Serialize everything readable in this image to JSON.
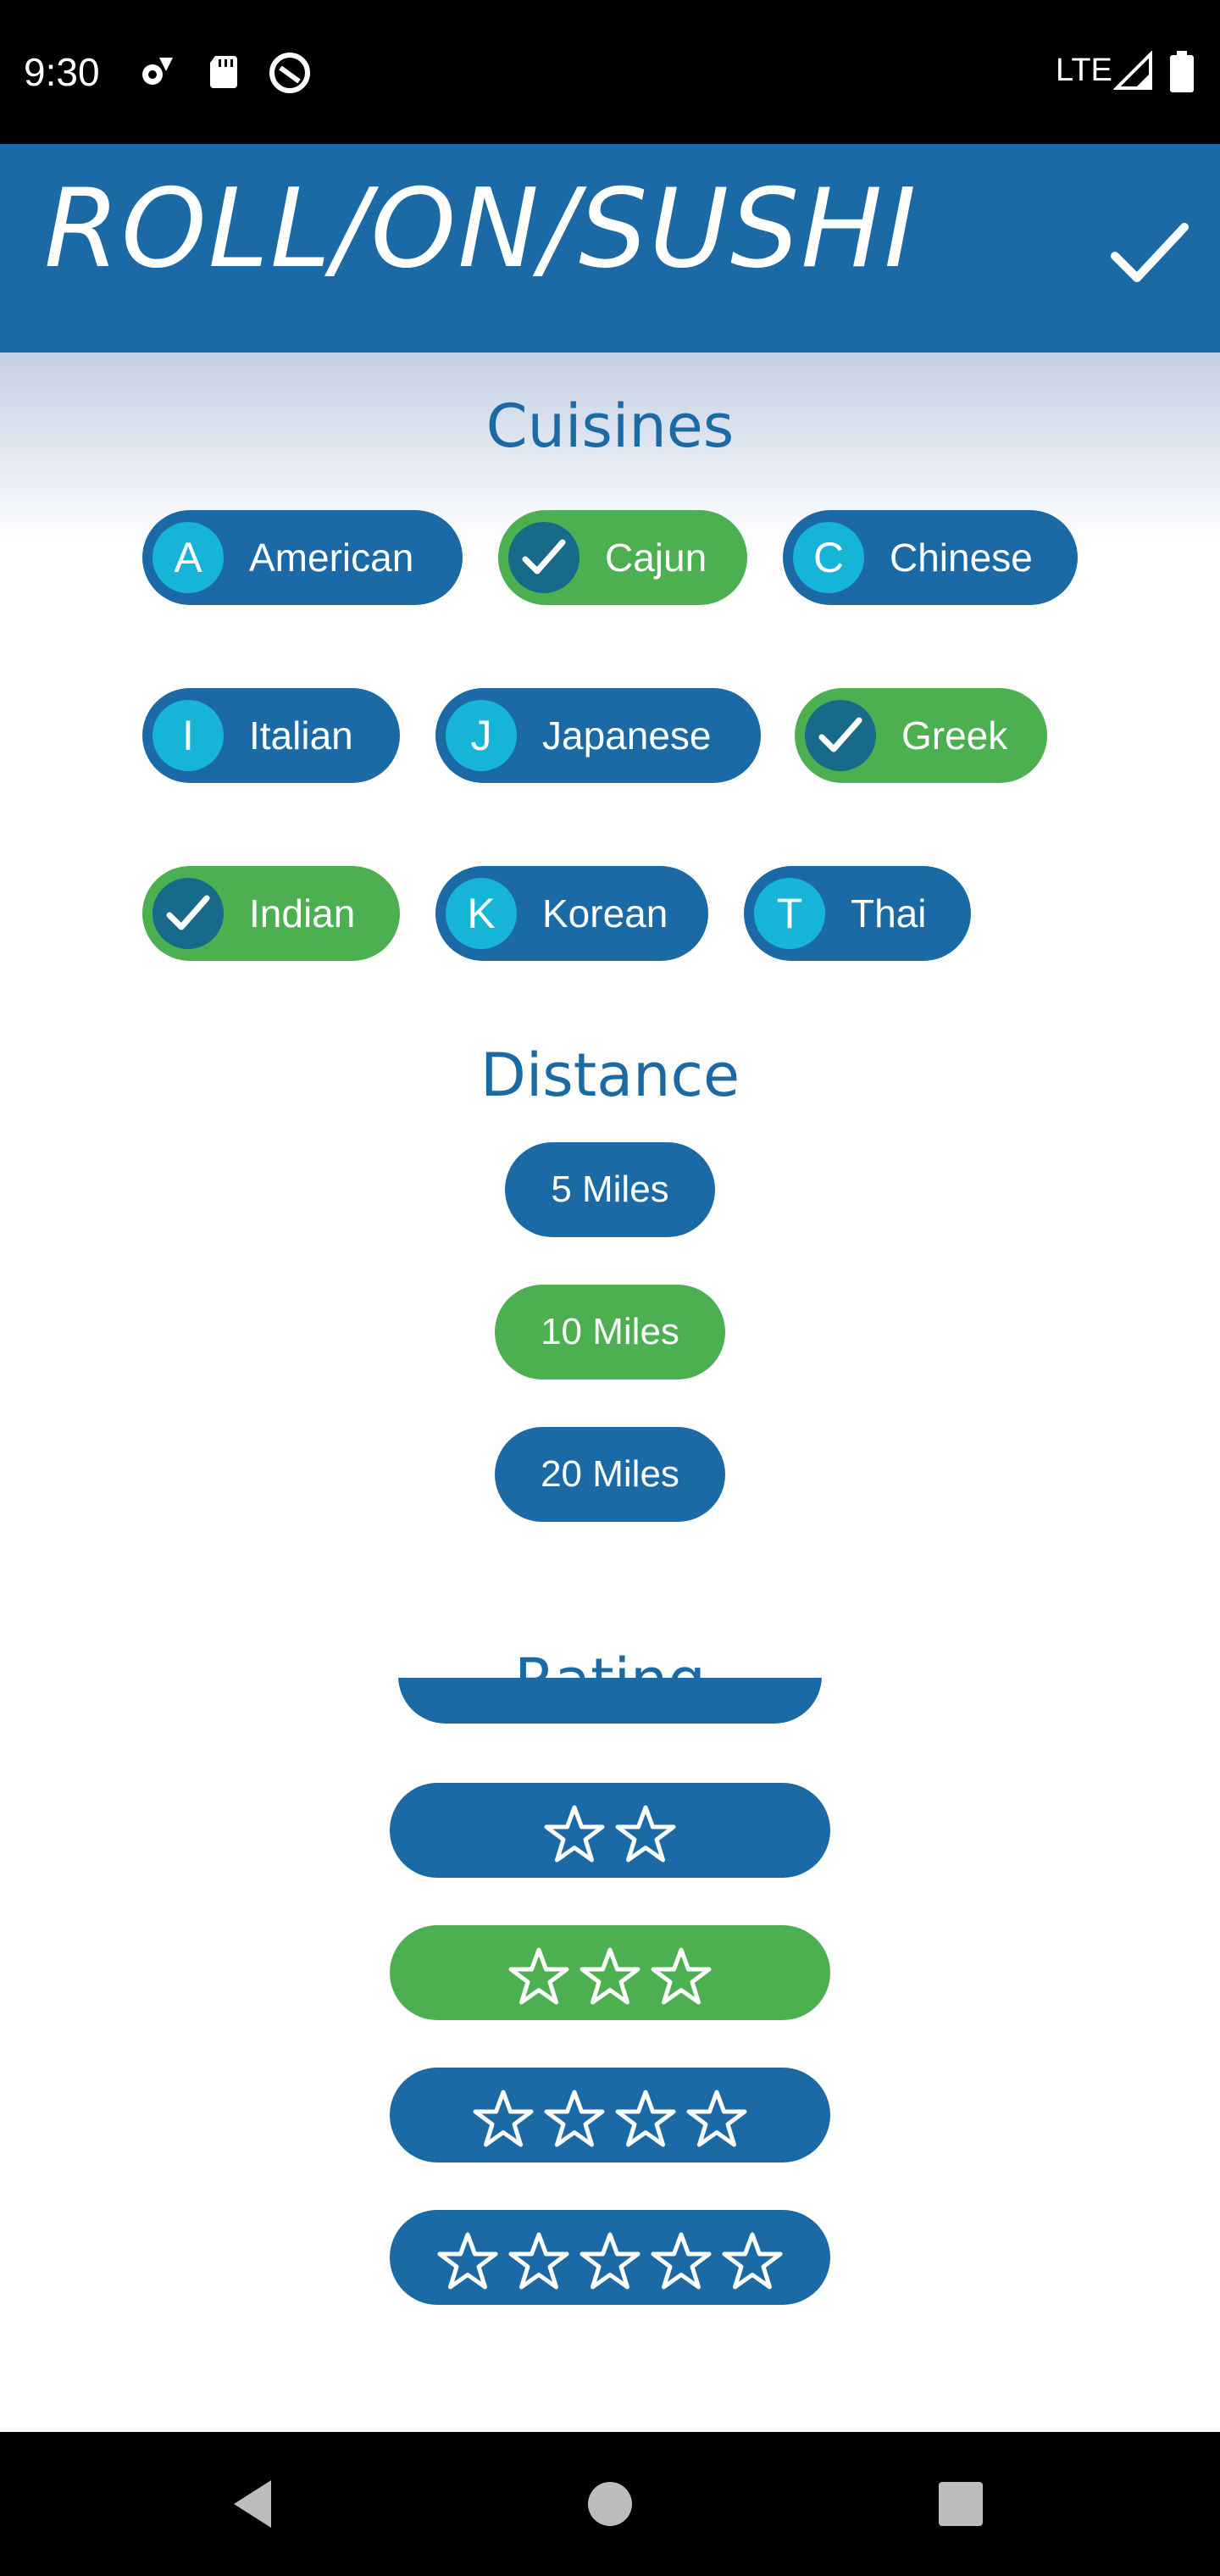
{
  "status_bar": {
    "time": "9:30",
    "network": "LTE",
    "icons": [
      "settings-icon",
      "sd-card-icon",
      "do-not-disturb-icon",
      "signal-icon",
      "battery-icon"
    ]
  },
  "app_bar": {
    "title": "ROLL/ON/SUSHI",
    "action_icon": "check-icon"
  },
  "cuisines": {
    "title": "Cuisines",
    "chips": [
      {
        "letter": "A",
        "label": "American",
        "selected": false
      },
      {
        "letter": "",
        "label": "Cajun",
        "selected": true
      },
      {
        "letter": "C",
        "label": "Chinese",
        "selected": false
      },
      {
        "letter": "I",
        "label": "Italian",
        "selected": false
      },
      {
        "letter": "J",
        "label": "Japanese",
        "selected": false
      },
      {
        "letter": "",
        "label": "Greek",
        "selected": true
      },
      {
        "letter": "",
        "label": "Indian",
        "selected": true
      },
      {
        "letter": "K",
        "label": "Korean",
        "selected": false
      },
      {
        "letter": "T",
        "label": "Thai",
        "selected": false
      }
    ]
  },
  "distance": {
    "title": "Distance",
    "options": [
      {
        "label": "5 Miles",
        "selected": false
      },
      {
        "label": "10 Miles",
        "selected": true
      },
      {
        "label": "20 Miles",
        "selected": false
      }
    ]
  },
  "rating": {
    "title": "Rating",
    "options": [
      {
        "stars": 2,
        "selected": false
      },
      {
        "stars": 3,
        "selected": true
      },
      {
        "stars": 4,
        "selected": false
      },
      {
        "stars": 5,
        "selected": false
      }
    ]
  },
  "nav_bar": {
    "icons": [
      "back-icon",
      "home-icon",
      "recents-icon"
    ]
  },
  "colors": {
    "primary": "#1b6aa5",
    "selected": "#4caf50",
    "avatar": "#16b5d8",
    "avatar_selected": "#176a8a"
  }
}
